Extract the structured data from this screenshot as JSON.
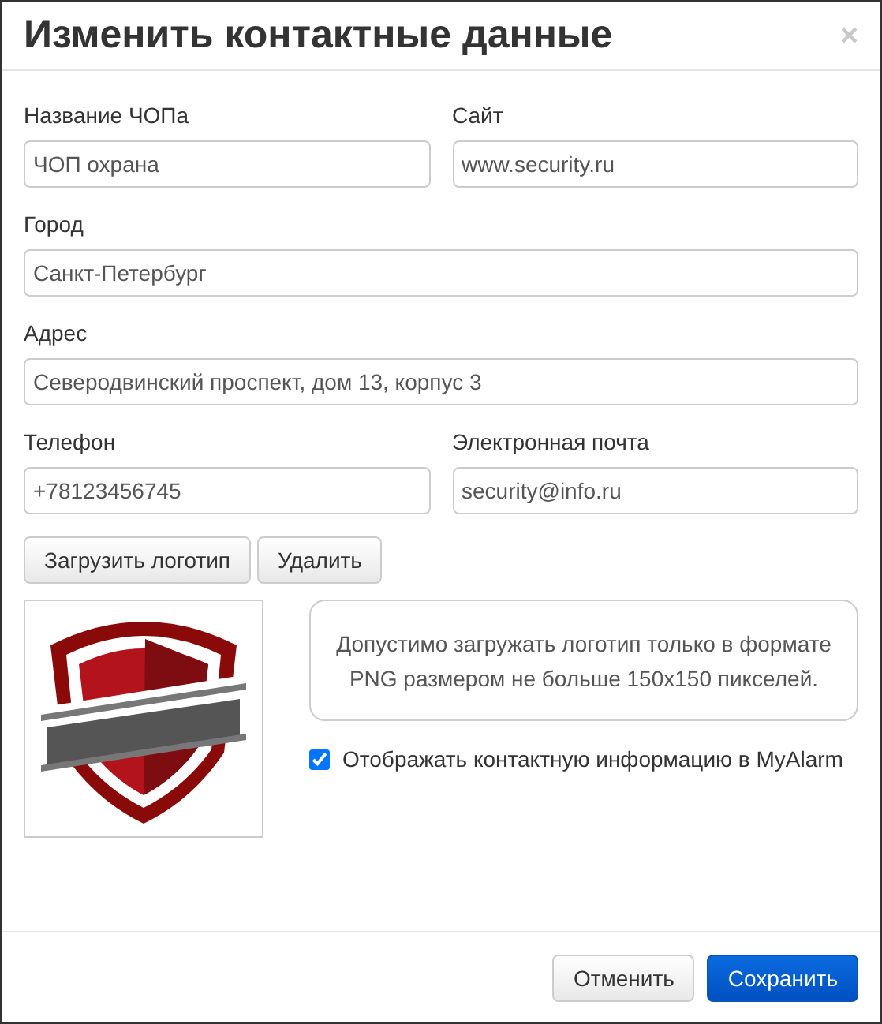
{
  "dialog": {
    "title": "Изменить контактные данные",
    "close": "×"
  },
  "rows": [
    [
      {
        "label": "Название ЧОПа",
        "value": "ЧОП охрана"
      },
      {
        "label": "Сайт",
        "value": "www.security.ru"
      }
    ],
    [
      {
        "label": "Город",
        "value": "Санкт-Петербург"
      }
    ],
    [
      {
        "label": "Адрес",
        "value": "Северодвинский проспект, дом 13, корпус 3"
      }
    ],
    [
      {
        "label": "Телефон",
        "value": "+78123456745"
      },
      {
        "label": "Электронная почта",
        "value": "security@info.ru"
      }
    ]
  ],
  "logo_buttons": [
    "Загрузить логотип",
    "Удалить"
  ],
  "logo": {
    "kind": "picture"
  },
  "hint": "Допустимо загружать логотип только в формате PNG размером не больше 150x150 пикселей.",
  "show_in_app": {
    "label": "Отображать контактную информацию в MyAlarm",
    "checked": true
  },
  "footer": {
    "cancel": "Отменить",
    "save": "Сохранить"
  }
}
